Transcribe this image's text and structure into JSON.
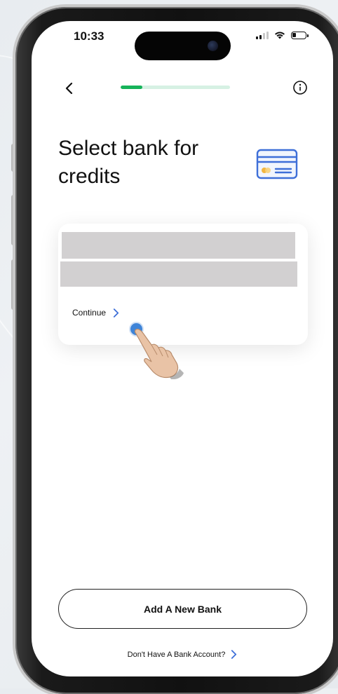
{
  "status_bar": {
    "time": "10:33"
  },
  "header": {
    "back_icon": "chevron-left-icon",
    "progress_fraction": 0.2,
    "progress_color": "#16b35a",
    "progress_track_color": "#d6f1e3",
    "info_icon": "info-circle-icon"
  },
  "main": {
    "title": "Select bank for credits",
    "title_icon": "credit-card-icon",
    "bank_card": {
      "continue_label": "Continue",
      "continue_icon": "chevron-right-icon",
      "redacted_color": "#d2d0d1"
    }
  },
  "footer": {
    "add_bank_label": "Add A New Bank",
    "no_bank_label": "Don't Have A Bank Account?",
    "no_bank_icon": "chevron-right-icon"
  },
  "colors": {
    "accent_blue": "#3e6fd8",
    "accent_green": "#16b35a",
    "tap_indicator": "#3e84d8"
  }
}
